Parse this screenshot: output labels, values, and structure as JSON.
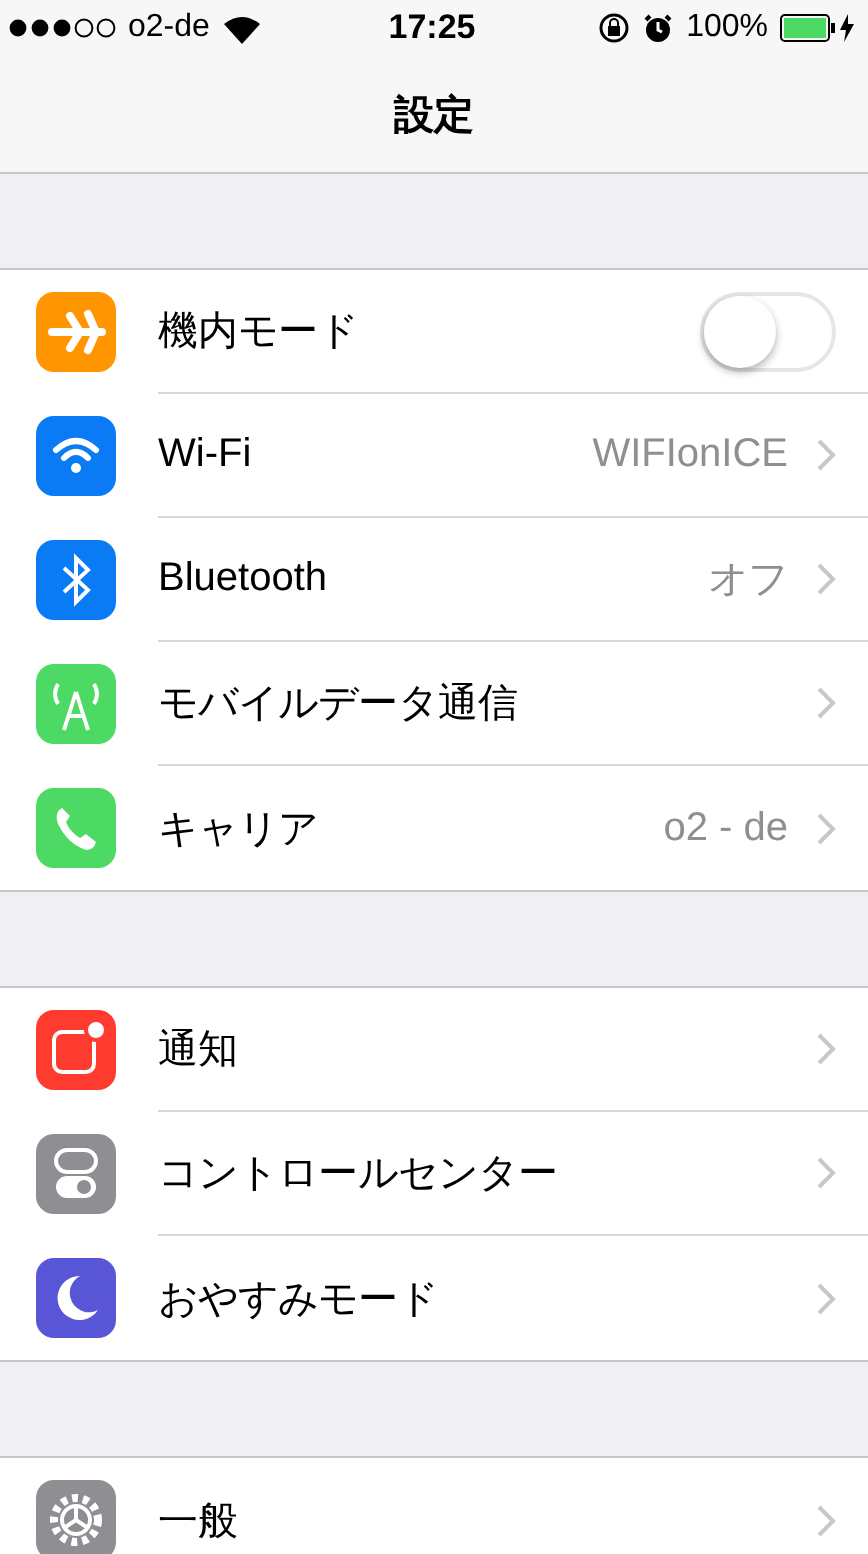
{
  "status_bar": {
    "carrier": "o2-de",
    "time": "17:25",
    "battery": "100%"
  },
  "navigation_bar": {
    "title": "設定"
  },
  "groups": [
    {
      "rows": [
        {
          "kind": "toggle",
          "label": "機内モード",
          "color": "#ff9500",
          "on": false
        },
        {
          "kind": "link",
          "label": "Wi-Fi",
          "value": "WIFIonICE",
          "color": "#0a7bf5"
        },
        {
          "kind": "link",
          "label": "Bluetooth",
          "value": "オフ",
          "color": "#0a7bf5"
        },
        {
          "kind": "link",
          "label": "モバイルデータ通信",
          "color": "#4cd964"
        },
        {
          "kind": "link",
          "label": "キャリア",
          "value": "o2 - de",
          "color": "#4cd964"
        }
      ]
    },
    {
      "rows": [
        {
          "kind": "link",
          "label": "通知",
          "color": "#ff3b30"
        },
        {
          "kind": "link",
          "label": "コントロールセンター",
          "color": "#8e8e93"
        },
        {
          "kind": "link",
          "label": "おやすみモード",
          "color": "#5856d6"
        }
      ]
    },
    {
      "rows": [
        {
          "kind": "link",
          "label": "一般",
          "color": "#8e8e93"
        }
      ]
    }
  ]
}
